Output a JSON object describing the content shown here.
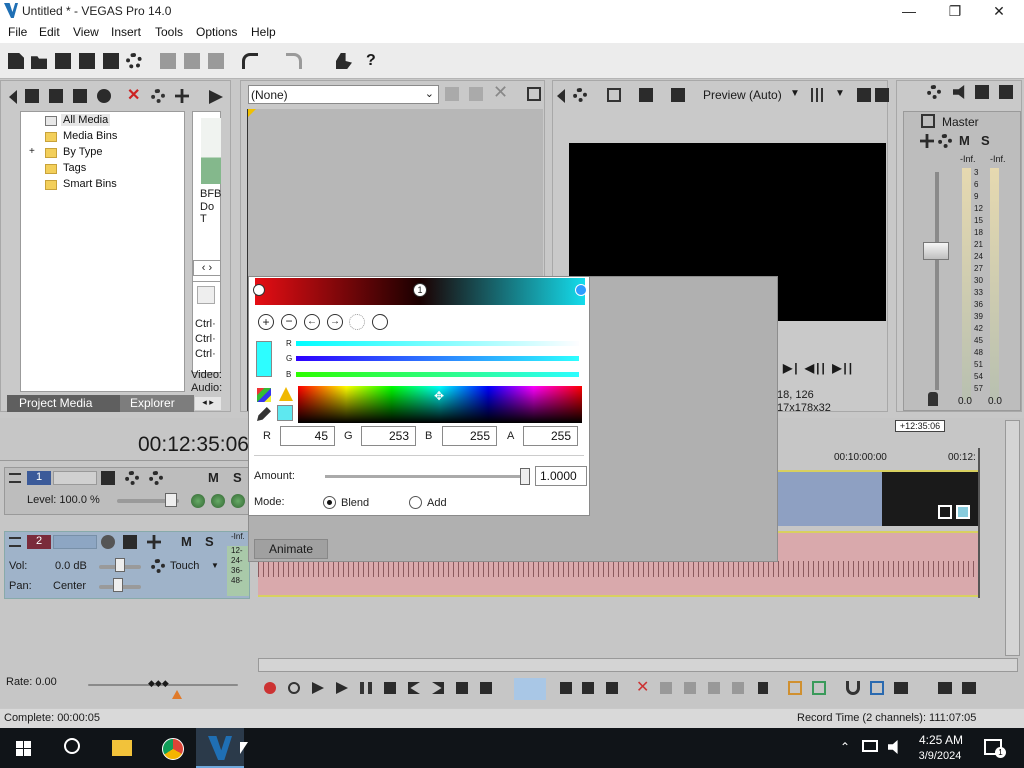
{
  "window": {
    "title": "Untitled * - VEGAS Pro 14.0",
    "minimize_glyph": "—",
    "maximize_glyph": "❐",
    "close_glyph": "✕"
  },
  "menu": [
    "File",
    "Edit",
    "View",
    "Insert",
    "Tools",
    "Options",
    "Help"
  ],
  "media_panel": {
    "tree": [
      "All Media",
      "Media Bins",
      "By Type",
      "Tags",
      "Smart Bins"
    ],
    "expander": "+",
    "tabs": {
      "active": "Project Media",
      "inactive": "Explorer"
    },
    "thumb_caption": [
      "BFB",
      "Do T"
    ],
    "ctrl_lines": [
      "Ctrl·",
      "Ctrl·",
      "Ctrl·"
    ],
    "video_label": "Video:",
    "audio_label": "Audio:"
  },
  "fx_panel": {
    "preset": "(None)"
  },
  "preview": {
    "mode_label": "Preview (Auto)",
    "coords": "18, 126",
    "frame_info": "17x178x32"
  },
  "mixer": {
    "label": "Master",
    "inf_left": "-Inf.",
    "inf_right": "-Inf.",
    "scale": [
      "3",
      "6",
      "9",
      "12",
      "15",
      "18",
      "21",
      "24",
      "27",
      "30",
      "33",
      "36",
      "39",
      "42",
      "45",
      "48",
      "51",
      "54",
      "57"
    ],
    "bottom_left": "0.0",
    "bottom_right": "0.0"
  },
  "timeline": {
    "timecode": "00:12:35:06",
    "cursor_label": "+12:35:06",
    "ruler": [
      "00:10:00:00",
      "00:12:"
    ],
    "rate_label": "Rate: 0.00"
  },
  "track1": {
    "number": "1",
    "level_label": "Level: 100.0 %",
    "m": "M",
    "s": "S"
  },
  "track2": {
    "number": "2",
    "vol_label": "Vol:",
    "vol_value": "0.0 dB",
    "pan_label": "Pan:",
    "pan_value": "Center",
    "touch_label": "Touch",
    "m": "M",
    "s": "S",
    "meter_top": "-Inf.",
    "meter_scale": [
      "12-",
      "24-",
      "36-",
      "48-"
    ]
  },
  "color_dialog": {
    "r_label": "R",
    "g_label": "G",
    "b_label": "B",
    "a_label": "A",
    "r_value": "45",
    "g_value": "253",
    "b_value": "255",
    "a_value": "255",
    "slider_r": "R",
    "slider_g": "G",
    "slider_b": "B",
    "marker_text": "1",
    "amount_label": "Amount:",
    "amount_value": "1.0000",
    "amount_fraction": 1.0,
    "mode_label": "Mode:",
    "blend_label": "Blend",
    "add_label": "Add",
    "selected_mode": "Blend",
    "animate_label": "Animate",
    "colors": {
      "current": "#2dfdff"
    }
  },
  "status": {
    "complete": "Complete: 00:00:05",
    "record_time": "Record Time (2 channels): 111:07:05"
  },
  "taskbar": {
    "time": "4:25 AM",
    "date": "3/9/2024",
    "notif_count": "1",
    "apps": [
      "windows-start-icon",
      "search-icon",
      "file-explorer-icon",
      "chrome-icon",
      "vegas-icon"
    ]
  }
}
